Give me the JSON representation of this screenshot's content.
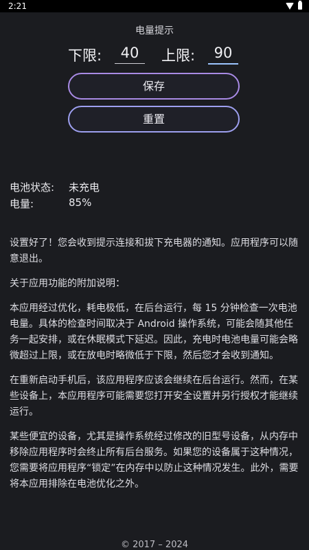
{
  "status_bar": {
    "time": "2:21"
  },
  "header": {
    "title": "电量提示"
  },
  "limits": {
    "lower_label": "下限:",
    "lower_value": "40",
    "upper_label": "上限:",
    "upper_value": "90"
  },
  "buttons": {
    "save": "保存",
    "reset": "重置"
  },
  "battery": {
    "status_label": "电池状态:",
    "status_value": "未充电",
    "level_label": "电量:",
    "level_value": "85%"
  },
  "info": {
    "p1": "设置好了！您会收到提示连接和拔下充电器的通知。应用程序可以随意退出。",
    "p2": "关于应用功能的附加说明：",
    "p3": "本应用经过优化，耗电极低，在后台运行，每 15 分钟检查一次电池电量。具体的检查时间取决于 Android 操作系统，可能会随其他任务一起安排，或在休眠模式下延迟。因此，充电时电池电量可能会略微超过上限，或在放电时略微低于下限，然后您才会收到通知。",
    "p4": "在重新启动手机后，该应用程序应该会继续在后台运行。然而，在某些设备上，本应用程序可能需要您打开安全设置并另行授权才能继续运行。",
    "p5": "某些便宜的设备，尤其是操作系统经过修改的旧型号设备，从内存中移除应用程序时会终止所有后台服务。如果您的设备属于这种情况，您需要将应用程序“锁定”在内存中以防止这种情况发生。此外，需要将本应用排除在电池优化之外。"
  },
  "footer": {
    "text": "© 2017 – 2024"
  }
}
